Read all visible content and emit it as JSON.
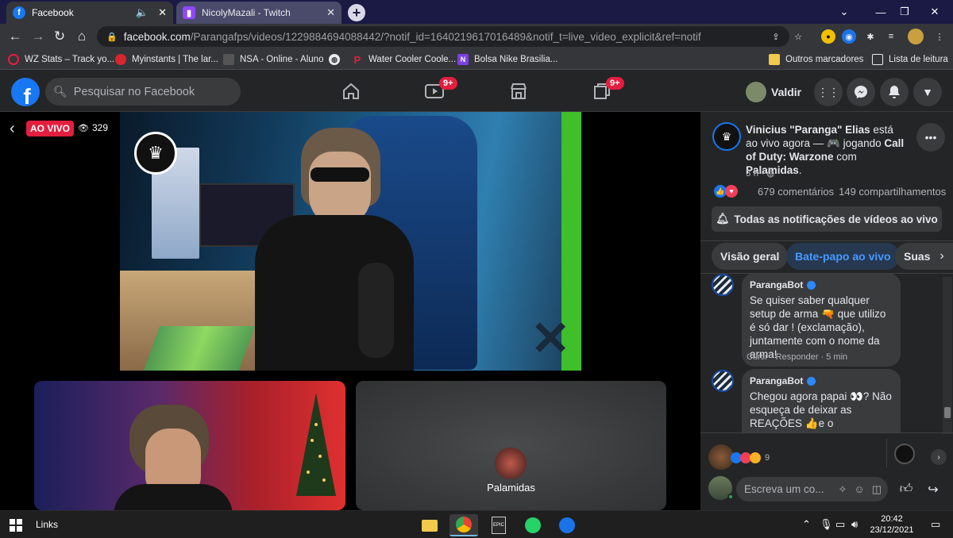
{
  "browser": {
    "tabs": [
      {
        "title": "Facebook",
        "icon": "facebook-icon",
        "active": true
      },
      {
        "title": "NicolyMazali - Twitch",
        "icon": "twitch-icon",
        "active": false
      }
    ],
    "new_tab_label": "+",
    "url_domain": "facebook.com",
    "url_path": "/Parangafps/videos/1229884694088442/?notif_id=1640219617016489&notif_t=live_video_explicit&ref=notif",
    "bookmarks": [
      {
        "label": "WZ Stats – Track yo...",
        "icon": "wz-stats-icon",
        "color": "#e41e3f"
      },
      {
        "label": "Myinstants | The lar...",
        "icon": "myinstants-icon",
        "color": "#d8262e"
      },
      {
        "label": "NSA - Online - Aluno",
        "icon": "nsa-icon",
        "color": "#6d6d6d"
      },
      {
        "label": "",
        "icon": "globe-icon",
        "color": "#e8eaed"
      },
      {
        "label": "Water Cooler Coole...",
        "icon": "water-cooler-icon",
        "color": "#e41e3f"
      },
      {
        "label": "Bolsa Nike Brasilia...",
        "icon": "nuvem-icon",
        "color": "#7b3fe4"
      }
    ],
    "other_bookmarks": "Outros marcadores",
    "reading_list": "Lista de leitura"
  },
  "facebook": {
    "search_placeholder": "Pesquisar no Facebook",
    "video_badge": "9+",
    "gaming_badge": "9+",
    "user_name": "Valdir"
  },
  "video": {
    "live_label": "AO VIVO",
    "viewer_count": "329",
    "guest_name": "Palamidas"
  },
  "post": {
    "author": "Vinicius \"Paranga\" Elias",
    "status_text": " está ao vivo agora — 🎮 jogando ",
    "game": "Call of Duty: Warzone",
    "with_text": " com ",
    "with_name": "Palamidas",
    "end": ".",
    "time": "3 h ·",
    "comments": "679 comentários",
    "shares": "149 compartilhamentos",
    "notify_button": "Todas as notificações de vídeos ao vivo"
  },
  "panel_tabs": [
    "Visão geral",
    "Bate-papo ao vivo",
    "Suas"
  ],
  "chat": [
    {
      "name": "ParangaBot",
      "text": "Se quiser saber qualquer setup de arma 🔫 que utilizo é só dar ! (exclamação), juntamente com o nome da arma!",
      "meta": "Curtir · Responder · 5 min"
    },
    {
      "name": "ParangaBot",
      "text": "Chegou agora papai 👀? Não esqueça de deixar as REAÇÕES 👍e o COMPARTILHAMENTO para ajudar o nosso META",
      "meta": ""
    }
  ],
  "reactions_count": "9",
  "comment_placeholder": "Escreva um co...",
  "taskbar": {
    "links_label": "Links",
    "time": "20:42",
    "date": "23/12/2021"
  }
}
